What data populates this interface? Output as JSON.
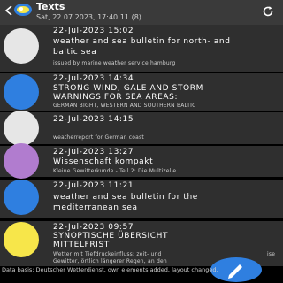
{
  "header": {
    "title": "Texts",
    "subtitle": "Sat, 22.07.2023, 17:40:11 (8)"
  },
  "rows": [
    {
      "color": "#e6e6e6",
      "date": "22-Jul-2023 15:02",
      "line1": "weather and sea bulletin for north- and",
      "line2": "baltic sea",
      "small": "issued by marine weather service hamburg"
    },
    {
      "color": "#2f7fe0",
      "date": "22-Jul-2023 14:34",
      "line1": "STRONG WIND, GALE AND STORM",
      "line2": "WARNINGS FOR SEA AREAS:",
      "small": "GERMAN BIGHT, WESTERN AND SOUTHERN BALTIC"
    },
    {
      "color": "#e6e6e6",
      "date": "22-Jul-2023 14:15",
      "small": "weatherreport for German coast"
    },
    {
      "color": "#b17ccf",
      "date": "22-Jul-2023 13:27",
      "line1": "Wissenschaft kompakt",
      "small": "Kleine Gewitterkunde - Teil 2: Die Multizelle..."
    },
    {
      "color": "#2f7fe0",
      "date": "22-Jul-2023 11:21",
      "line1": "weather and sea bulletin for the",
      "line2": "mediterranean sea"
    },
    {
      "color": "#f7e64a",
      "date": "22-Jul-2023 09:57",
      "line1": "SYNOPTISCHE ÜBERSICHT",
      "line2": "MITTELFRIST",
      "small": "Wetter mit Tiefdruckeinfluss: zeit- und",
      "small_end": "ise",
      "small2": "Gewitter, örtlich längerer Regen, an den"
    }
  ],
  "footer": {
    "text": "Data basis: Deutscher Wetterdienst, own elements added, layout changed."
  },
  "colors": {
    "topbar": "#3a3a3a",
    "row_bg": "#2f2f2f",
    "fab": "#2f7fe0"
  }
}
